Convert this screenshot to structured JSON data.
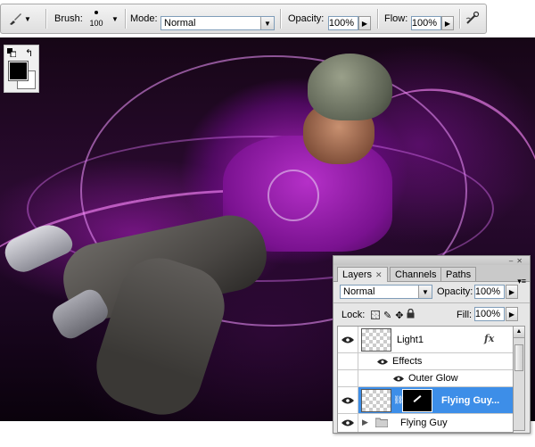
{
  "options_bar": {
    "brush_label": "Brush:",
    "brush_size": "100",
    "mode_label": "Mode:",
    "mode_value": "Normal",
    "opacity_label": "Opacity:",
    "opacity_value": "100%",
    "flow_label": "Flow:",
    "flow_value": "100%"
  },
  "colors": {
    "foreground": "#000000",
    "background": "#ffffff"
  },
  "layers_panel": {
    "tabs": [
      {
        "label": "Layers",
        "active": true
      },
      {
        "label": "Channels",
        "active": false
      },
      {
        "label": "Paths",
        "active": false
      }
    ],
    "blend_mode": "Normal",
    "opacity_label": "Opacity:",
    "opacity_value": "100%",
    "lock_label": "Lock:",
    "fill_label": "Fill:",
    "fill_value": "100%",
    "layers": [
      {
        "name": "Light1",
        "has_fx": true,
        "fx_label": "fx",
        "selected": false
      },
      {
        "name": "Effects"
      },
      {
        "name": "Outer Glow"
      },
      {
        "name": "Flying Guy...",
        "selected": true
      },
      {
        "name": "Flying Guy",
        "type": "group"
      }
    ]
  },
  "accent": "#3d8ee8"
}
